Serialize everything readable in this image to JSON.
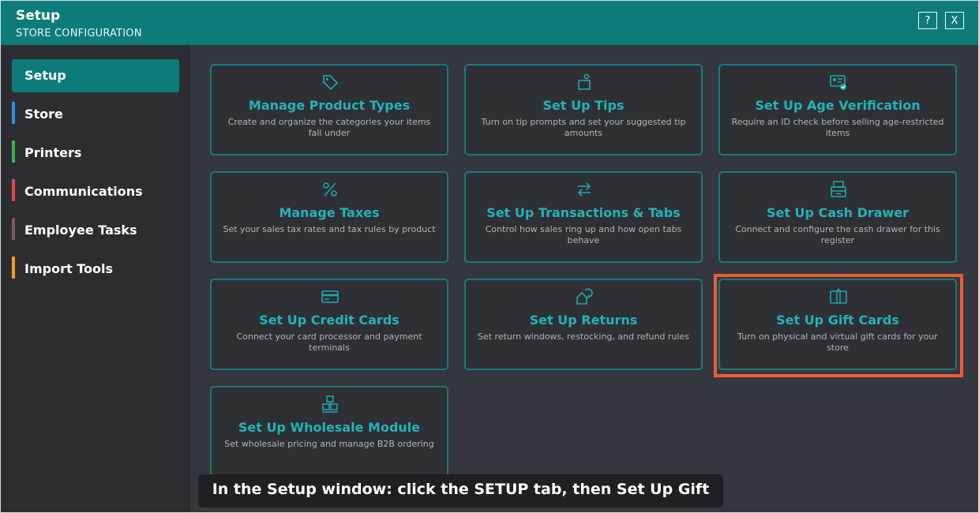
{
  "window": {
    "title": "Setup",
    "subtitle": "STORE CONFIGURATION",
    "help_label": "?",
    "close_label": "X"
  },
  "sidebar": {
    "items": [
      {
        "label": "Setup",
        "active": true
      },
      {
        "label": "Store",
        "color": "#2f8fe6"
      },
      {
        "label": "Printers",
        "color": "#3db24a"
      },
      {
        "label": "Communications",
        "color": "#e94545"
      },
      {
        "label": "Employee Tasks",
        "color": "#7a5c58"
      },
      {
        "label": "Import Tools",
        "color": "#f1a020"
      }
    ]
  },
  "cards": [
    {
      "icon": "tag-icon",
      "title": "Manage Product Types",
      "desc": "Create and organize the categories your items fall under"
    },
    {
      "icon": "tip-jar-icon",
      "title": "Set Up Tips",
      "desc": "Turn on tip prompts and set your suggested tip amounts"
    },
    {
      "icon": "id-card-check-icon",
      "title": "Set Up Age Verification",
      "desc": "Require an ID check before selling age-restricted items"
    },
    {
      "icon": "percent-icon",
      "title": "Manage Taxes",
      "desc": "Set your sales tax rates and tax rules by product"
    },
    {
      "icon": "swap-arrows-icon",
      "title": "Set Up Transactions & Tabs",
      "desc": "Control how sales ring up and how open tabs behave"
    },
    {
      "icon": "cash-drawer-icon",
      "title": "Set Up Cash Drawer",
      "desc": "Connect and configure the cash drawer for this register"
    },
    {
      "icon": "credit-card-icon",
      "title": "Set Up Credit Cards",
      "desc": "Connect your card processor and payment terminals"
    },
    {
      "icon": "return-icon",
      "title": "Set Up Returns",
      "desc": "Set return windows, restocking, and refund rules"
    },
    {
      "icon": "gift-card-icon",
      "title": "Set Up Gift Cards",
      "desc": "Turn on physical and virtual gift cards for your store"
    },
    {
      "icon": "wholesale-boxes-icon",
      "title": "Set Up Wholesale Module",
      "desc": "Set wholesale pricing and manage B2B ordering"
    }
  ],
  "caption": "In the Setup window: click the SETUP tab, then Set Up Gift Cards.",
  "colors": {
    "accent": "#0e7b7b",
    "card_title": "#22b4b4",
    "highlight": "#ea5a37"
  }
}
